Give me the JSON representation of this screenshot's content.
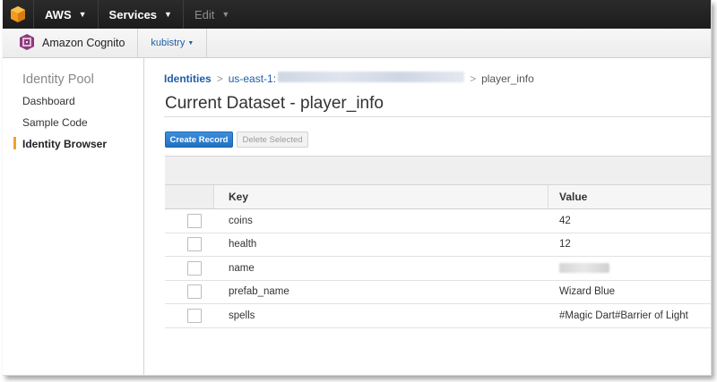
{
  "topnav": {
    "logo_icon": "aws-cube-icon",
    "aws_label": "AWS",
    "services_label": "Services",
    "edit_label": "Edit"
  },
  "servicebar": {
    "service_icon": "cognito-icon",
    "service_name": "Amazon Cognito",
    "region_label": "kubistry"
  },
  "sidebar": {
    "title": "Identity Pool",
    "items": [
      {
        "label": "Dashboard"
      },
      {
        "label": "Sample Code"
      },
      {
        "label": "Identity Browser",
        "active": true
      }
    ]
  },
  "breadcrumb": {
    "root": "Identities",
    "identity_prefix": "us-east-1:",
    "current": "player_info"
  },
  "page_title": "Current Dataset - player_info",
  "buttons": {
    "create": "Create Record",
    "delete": "Delete Selected"
  },
  "table": {
    "columns": [
      "Key",
      "Value"
    ],
    "rows": [
      {
        "key": "coins",
        "value": "42"
      },
      {
        "key": "health",
        "value": "12"
      },
      {
        "key": "name",
        "value": ""
      },
      {
        "key": "prefab_name",
        "value": "Wizard Blue"
      },
      {
        "key": "spells",
        "value": "#Magic Dart#Barrier of Light"
      }
    ]
  },
  "colors": {
    "accent_orange": "#f0a030",
    "link_blue": "#1f5da8",
    "primary_button": "#2271c2",
    "nav_dark": "#232323"
  }
}
